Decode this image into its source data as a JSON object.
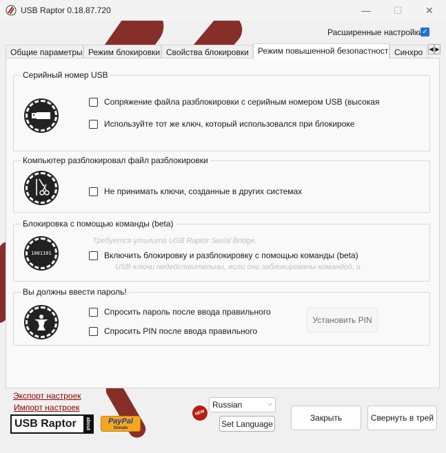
{
  "window": {
    "title": "USB Raptor 0.18.87.720",
    "minimize_glyph": "—",
    "maximize_glyph": "☐",
    "close_glyph": "✕"
  },
  "advanced": {
    "label": "Расширенные настройки",
    "checked": true
  },
  "tabs": [
    {
      "label": "Общие параметры"
    },
    {
      "label": "Режим блокировки"
    },
    {
      "label": "Свойства блокировки"
    },
    {
      "label": "Режим повышенной безопастности",
      "active": true
    },
    {
      "label": "Синхро"
    }
  ],
  "groups": {
    "serial": {
      "title": "Серийный номер USB",
      "options": [
        "Сопряжение файла разблокировки с серийным номером USB (высокая",
        "Используйте тот же ключ, который использовался при блокироке"
      ]
    },
    "computer": {
      "title": "Компьютер разблокировал файл разблокировки",
      "options": [
        "Не принимать ключи, созданные в других системах"
      ]
    },
    "command": {
      "title": "Блокировка с помощью команды (beta)",
      "hint_top": "Требуется утилита USB Raptor Serial Bridge.",
      "options": [
        "Включить блокировку и разблокировку с помощью команды (beta)"
      ],
      "hint_bottom": "USB-ключи недействительны, если они заблокированы командой, и",
      "icon_text": "1001101"
    },
    "password": {
      "title": "Вы должны ввести пароль!",
      "options": [
        "Спросить пароль после ввода правильного",
        "Спросить PIN после ввода правильного"
      ],
      "set_pin_label": "Установить PIN"
    }
  },
  "footer": {
    "export_link": "Экспорт настроек",
    "import_link": "Импорт настроек",
    "logo_text": "USB Raptor",
    "logo_about": "about",
    "paypal_text": "PayPal",
    "paypal_sub": "Donate",
    "new_badge": "NEW",
    "language_value": "Russian",
    "set_language_label": "Set Language",
    "close_label": "Закрыть",
    "tray_label": "Свернуть в трей"
  },
  "colors": {
    "accent": "#1f6fd1",
    "link": "#8b0000",
    "background_stroke": "#7a1a12"
  }
}
